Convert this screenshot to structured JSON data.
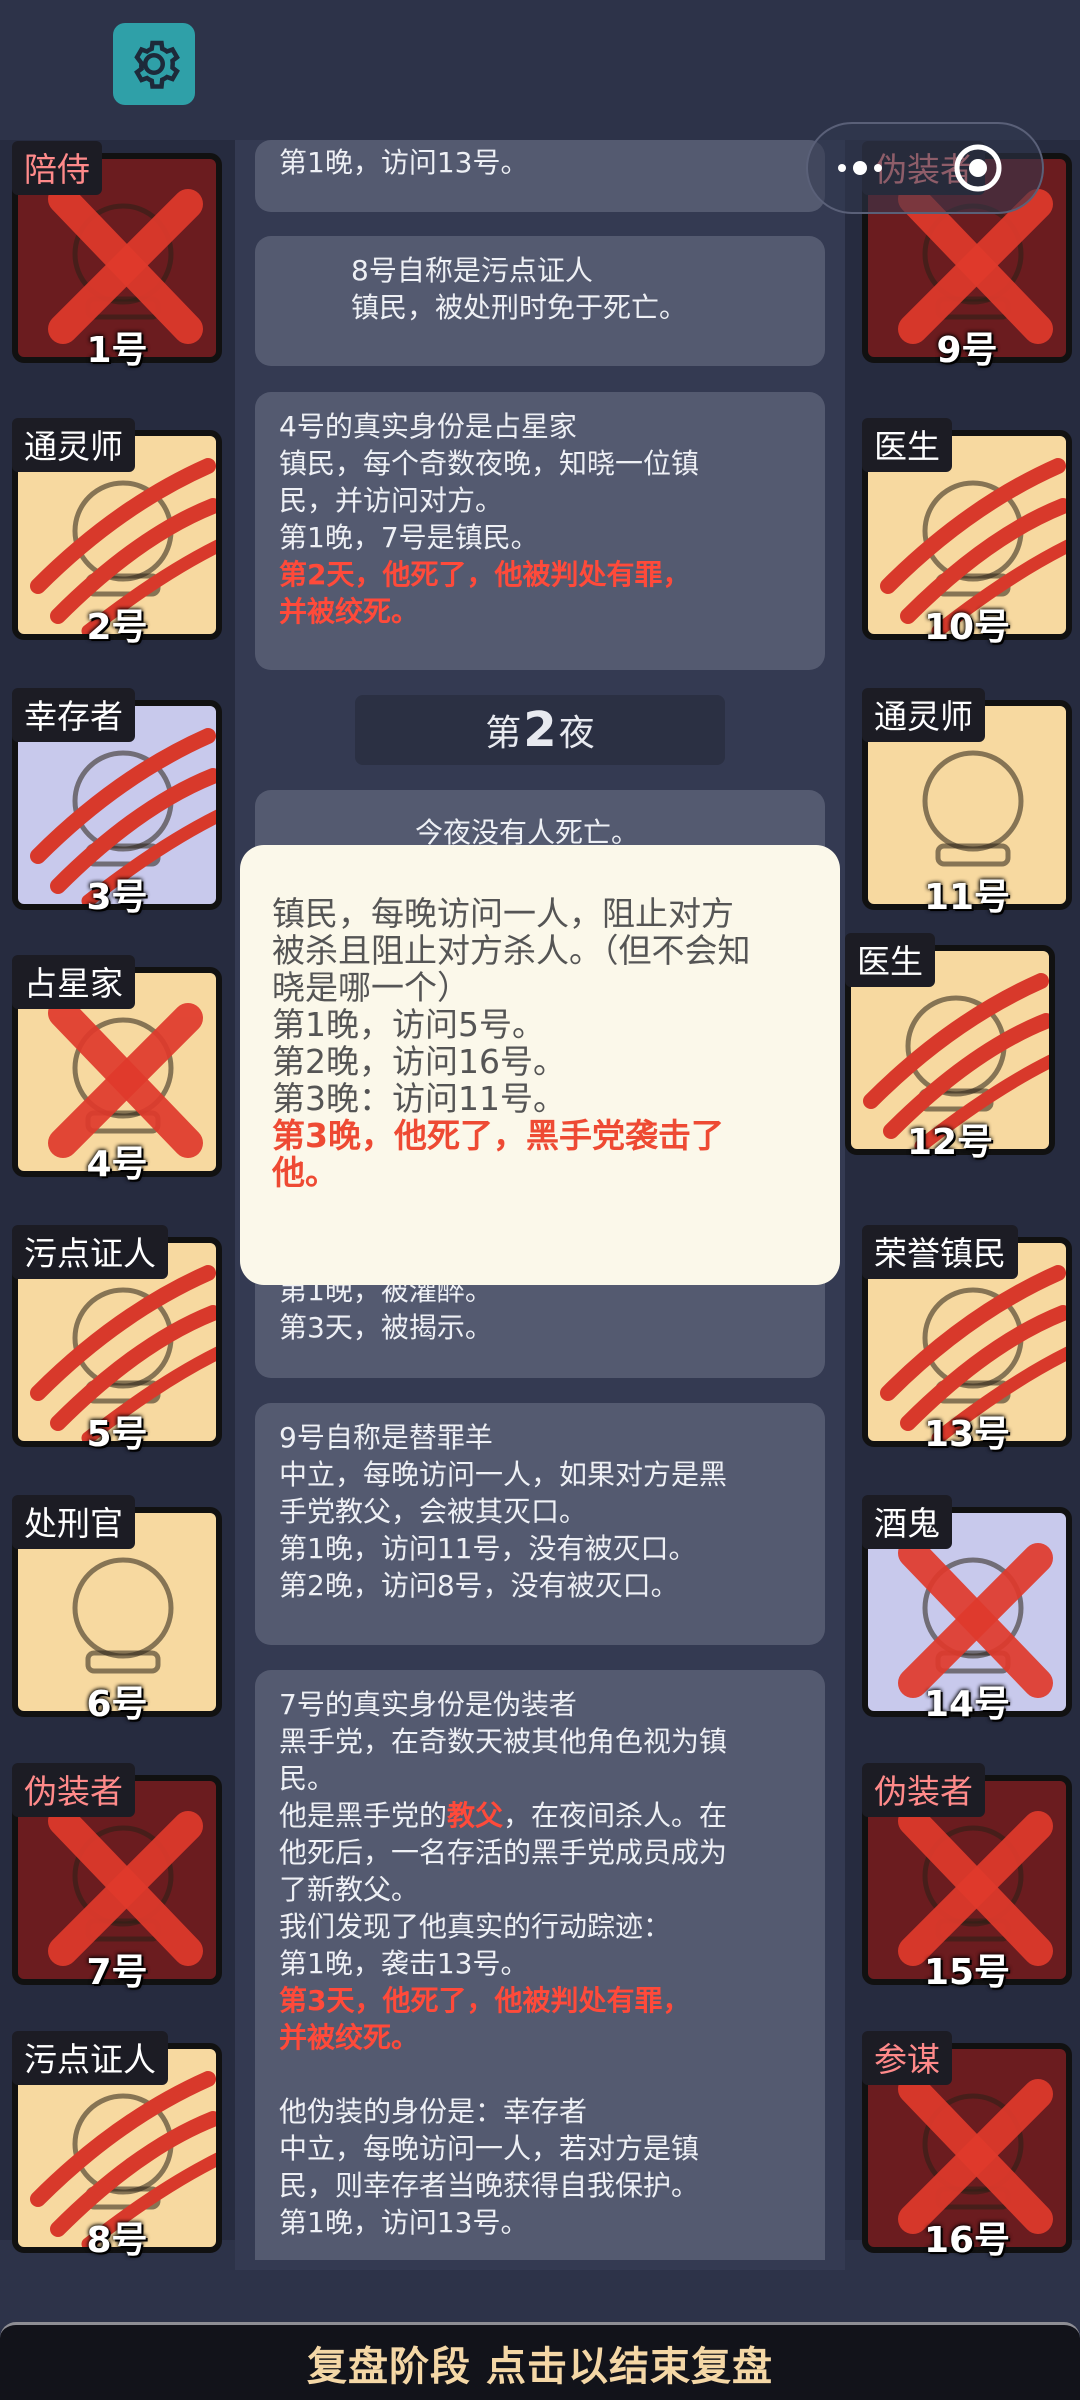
{
  "top": {
    "settings_icon": "gear-icon",
    "menu_icon": "more-dots-icon",
    "close_icon": "target-icon"
  },
  "left_players": [
    {
      "role": "陪侍",
      "number": "1号",
      "mark": "x",
      "bg": "dark",
      "role_color": "red"
    },
    {
      "role": "通灵师",
      "number": "2号",
      "mark": "claw",
      "bg": "tan",
      "role_color": "white"
    },
    {
      "role": "幸存者",
      "number": "3号",
      "mark": "claw",
      "bg": "blue",
      "role_color": "white"
    },
    {
      "role": "占星家",
      "number": "4号",
      "mark": "x",
      "bg": "tan",
      "role_color": "white"
    },
    {
      "role": "污点证人",
      "number": "5号",
      "mark": "claw",
      "bg": "tan",
      "role_color": "white"
    },
    {
      "role": "处刑官",
      "number": "6号",
      "mark": "none",
      "bg": "tan",
      "role_color": "white"
    },
    {
      "role": "伪装者",
      "number": "7号",
      "mark": "x",
      "bg": "dark",
      "role_color": "red"
    },
    {
      "role": "污点证人",
      "number": "8号",
      "mark": "claw",
      "bg": "tan",
      "role_color": "white"
    }
  ],
  "right_players": [
    {
      "role": "伪装者",
      "number": "9号",
      "mark": "x",
      "bg": "dark",
      "role_color": "red"
    },
    {
      "role": "医生",
      "number": "10号",
      "mark": "claw",
      "bg": "tan",
      "role_color": "white"
    },
    {
      "role": "通灵师",
      "number": "11号",
      "mark": "none",
      "bg": "tan",
      "role_color": "white"
    },
    {
      "role": "医生",
      "number": "12号",
      "mark": "claw",
      "bg": "tan",
      "role_color": "white"
    },
    {
      "role": "荣誉镇民",
      "number": "13号",
      "mark": "claw",
      "bg": "tan",
      "role_color": "white"
    },
    {
      "role": "酒鬼",
      "number": "14号",
      "mark": "x",
      "bg": "blue",
      "role_color": "white"
    },
    {
      "role": "伪装者",
      "number": "15号",
      "mark": "x",
      "bg": "dark",
      "role_color": "red"
    },
    {
      "role": "参谋",
      "number": "16号",
      "mark": "x",
      "bg": "dark",
      "role_color": "red"
    }
  ],
  "log": {
    "e0": {
      "l1": "第1晚，访问13号。"
    },
    "e1": {
      "l1": "8号自称是污点证人",
      "l2": "镇民，被处刑时免于死亡。"
    },
    "e2": {
      "l1": "4号的真实身份是占星家",
      "l2": "镇民，每个奇数夜晚，知晓一位镇",
      "l3": "民，并访问对方。",
      "l4": "第1晚，7号是镇民。",
      "r1": "第2天，他死了，他被判处有罪，",
      "r2": "并被绞死。"
    },
    "night_prefix": "第",
    "night_number": "2",
    "night_suffix": "夜",
    "e3": {
      "l1": "今夜没有人死亡。"
    },
    "e4": {
      "l1": "第1晚，被灌醉。",
      "l2": "第3天，被揭示。"
    },
    "e5": {
      "l1": "9号自称是替罪羊",
      "l2": "中立，每晚访问一人，如果对方是黑",
      "l3": "手党教父，会被其灭口。",
      "l4": "第1晚，访问11号，没有被灭口。",
      "l5": "第2晚，访问8号，没有被灭口。"
    },
    "e6": {
      "l1": "7号的真实身份是伪装者",
      "l2": "黑手党，在奇数天被其他角色视为镇",
      "l3": "民。",
      "l4a": "他是黑手党的",
      "l4b": "教父",
      "l4c": "，在夜间杀人。在",
      "l5": "他死后，一名存活的黑手党成员成为",
      "l6": "了新教父。",
      "l7": "我们发现了他真实的行动踪迹：",
      "l8": "第1晚，袭击13号。",
      "r1": "第3天，他死了，他被判处有罪，",
      "r2": "并被绞死。",
      "l9": "他伪装的身份是：幸存者",
      "l10": "中立，每晚访问一人，若对方是镇",
      "l11": "民，则幸存者当晚获得自我保护。",
      "l12": "第1晚，访问13号。"
    }
  },
  "popup": {
    "l1": "镇民，每晚访问一人，阻止对方",
    "l2": "被杀且阻止对方杀人。（但不会知",
    "l3": "晓是哪一个）",
    "l4": "第1晚，访问5号。",
    "l5": "第2晚，访问16号。",
    "l6": "第3晚：访问11号。",
    "r1": "第3晚，他死了，黑手党袭击了",
    "r2": "他。"
  },
  "bottom_bar": {
    "label": "复盘阶段 点击以结束复盘"
  },
  "colors": {
    "accent_red": "#ff4a3a",
    "card_tan": "#f7d9a0",
    "card_dark": "#6b1c1f",
    "card_blue": "#c8c9ec",
    "bottom_text": "#f4d7a6"
  }
}
